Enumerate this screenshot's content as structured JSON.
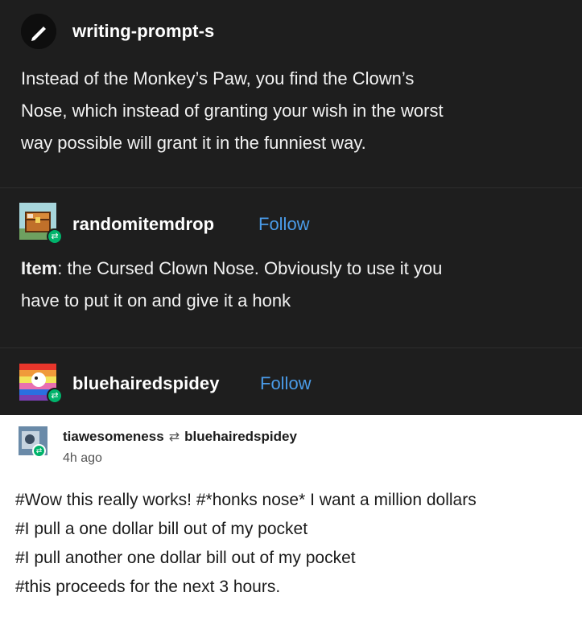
{
  "post1": {
    "username": "writing-prompt-s",
    "avatar_icon": "pen-icon",
    "text_lines": [
      "Instead of the Monkey’s Paw, you find the Clown’s",
      "Nose, which instead of granting your wish in the worst",
      "way possible will grant it in the funniest way."
    ]
  },
  "post2": {
    "username": "randomitemdrop",
    "follow_label": "Follow",
    "item_label": "Item",
    "text_line1_rest": ": the Cursed Clown Nose. Obviously to use it you",
    "text_line2": "have to put it on and give it a honk"
  },
  "post3": {
    "username": "bluehairedspidey",
    "follow_label": "Follow"
  },
  "post4": {
    "reblogger": "tiawesomeness",
    "reblog_icon": "reblog-icon",
    "source": "bluehairedspidey",
    "time": "4h ago",
    "tag_lines": [
      "#Wow this really works!  #*honks nose* I want a million dollars",
      "#I pull a one dollar bill out of my pocket",
      "#I pull another one dollar bill out of my pocket",
      "#this proceeds for the next 3 hours."
    ]
  },
  "colors": {
    "dark_bg": "#1e1e1e",
    "follow_blue": "#4a9be8",
    "reblog_green": "#00b36b"
  }
}
